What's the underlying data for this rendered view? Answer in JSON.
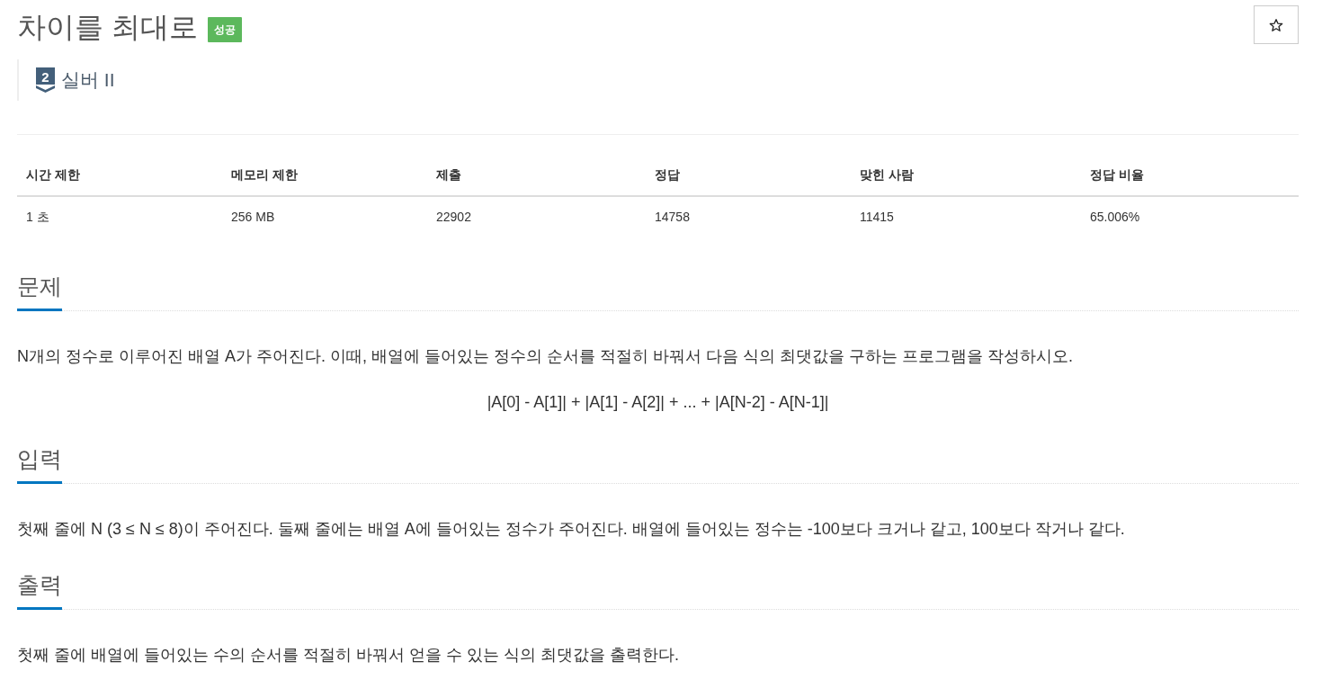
{
  "problem": {
    "title": "차이를 최대로",
    "result_badge": "성공",
    "favorite": {
      "on": false
    }
  },
  "tier": {
    "number": "2",
    "name": "실버 II"
  },
  "stats": {
    "columns": [
      "시간 제한",
      "메모리 제한",
      "제출",
      "정답",
      "맞힌 사람",
      "정답 비율"
    ],
    "rows": [
      [
        "1 초",
        "256 MB",
        "22902",
        "14758",
        "11415",
        "65.006%"
      ]
    ]
  },
  "sections": [
    {
      "heading": "문제",
      "blocks": [
        {
          "kind": "text",
          "text": "N개의 정수로 이루어진 배열 A가 주어진다. 이때, 배열에 들어있는 정수의 순서를 적절히 바꿔서 다음 식의 최댓값을 구하는 프로그램을 작성하시오."
        },
        {
          "kind": "formula",
          "text": "|A[0] - A[1]| + |A[1] - A[2]| + ... + |A[N-2] - A[N-1]|"
        }
      ]
    },
    {
      "heading": "입력",
      "blocks": [
        {
          "kind": "text",
          "text": "첫째 줄에 N (3 ≤ N ≤ 8)이 주어진다. 둘째 줄에는 배열 A에 들어있는 정수가 주어진다. 배열에 들어있는 정수는 -100보다 크거나 같고, 100보다 작거나 같다."
        }
      ]
    },
    {
      "heading": "출력",
      "blocks": [
        {
          "kind": "text",
          "text": "첫째 줄에 배열에 들어있는 수의 순서를 적절히 바꿔서 얻을 수 있는 식의 최댓값을 출력한다."
        }
      ]
    }
  ]
}
